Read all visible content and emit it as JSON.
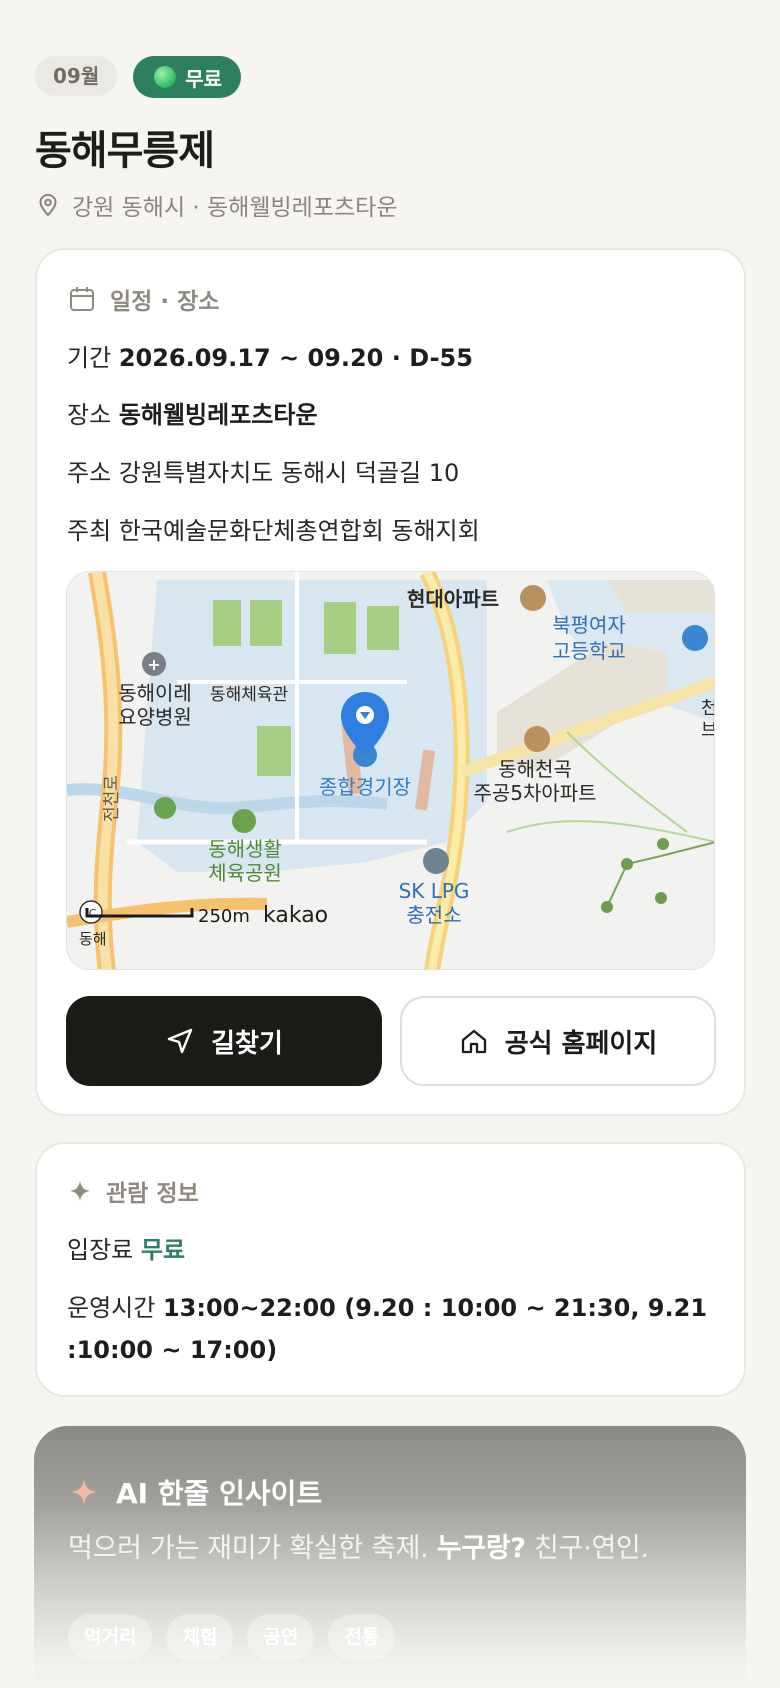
{
  "chips": {
    "month": "09월",
    "price": "무료"
  },
  "event": {
    "title": "동해무릉제",
    "location": "강원 동해시 · 동해웰빙레포츠타운"
  },
  "schedule": {
    "heading": "일정 · 장소",
    "period_label": "기간",
    "period_value": "2026.09.17 ~ 09.20 · D-55",
    "venue_label": "장소",
    "venue_value": "동해웰빙레포츠타운",
    "address_label": "주소",
    "address_value": "강원특별자치도 동해시 덕골길 10",
    "host_label": "주최",
    "host_value": "한국예술문화단체총연합회 동해지회"
  },
  "map": {
    "labels": {
      "apt1": "현대아파트",
      "school_line1": "북평여자",
      "school_line2": "고등학교",
      "hospital_line1": "동해이레",
      "hospital_line2": "요양병원",
      "gym": "동해체육관",
      "stadium": "종합경기장",
      "apt2_line1": "동해천곡",
      "apt2_line2": "주공5차아파트",
      "park_line1": "동해생활",
      "park_line2": "체육공원",
      "lpg_line1": "SK LPG",
      "lpg_line2": "충전소",
      "river": "전천로",
      "edge_right_1": "천",
      "edge_right_2": "브",
      "edge_bottom": "동해",
      "scale": "250m",
      "brand": "kakao"
    }
  },
  "buttons": {
    "directions": "길찾기",
    "homepage": "공식 홈페이지"
  },
  "viewing": {
    "heading": "관람 정보",
    "fee_label": "입장료",
    "fee_value": "무료",
    "hours_label": "운영시간",
    "hours_value_line1": "13:00~22:00 (9.20 : 10:00 ~ 21:30, 9.21",
    "hours_value_line2": ":10:00 ~ 17:00)"
  },
  "ai": {
    "heading": "AI 한줄 인사이트",
    "text_before": "먹으러 가는 재미가 확실한 축제.",
    "text_bold": "누구랑?",
    "text_after": "친구·연인.",
    "tags": [
      "먹거리",
      "체험",
      "공연",
      "전통"
    ]
  },
  "colors": {
    "accent_green": "#2e7f5d",
    "dark_button": "#1d1b18",
    "map_pin": "#2f7fe0"
  }
}
